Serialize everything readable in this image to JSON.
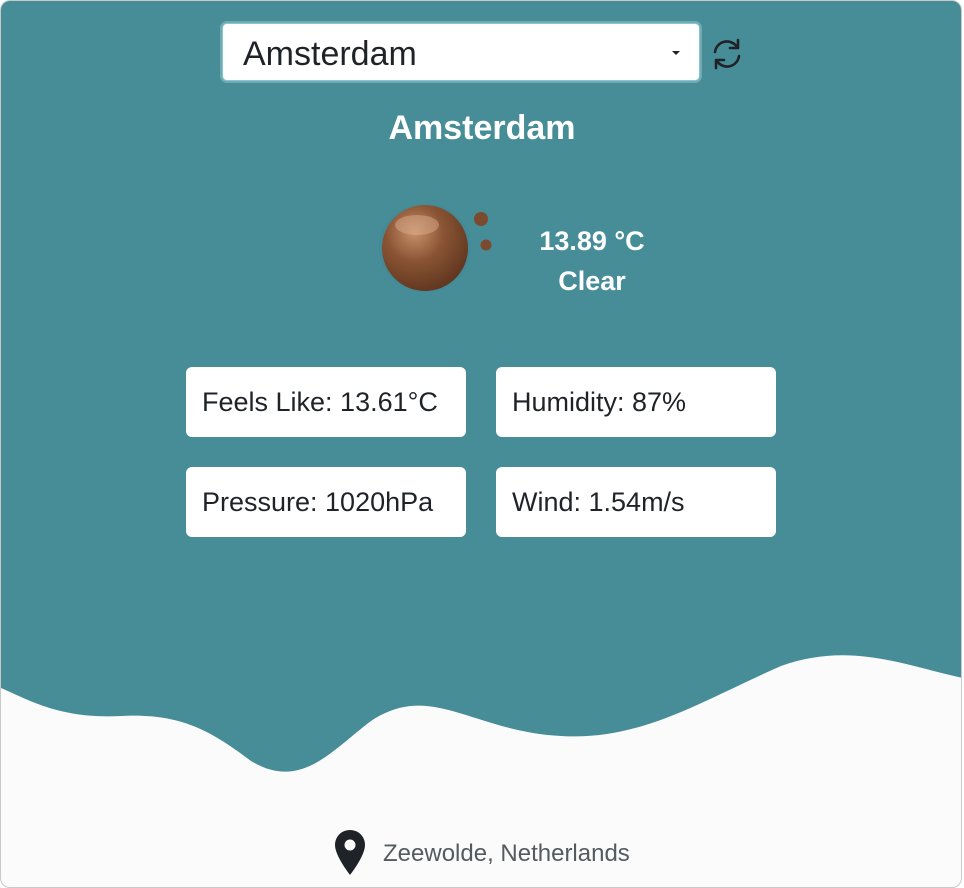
{
  "selector": {
    "selected_city": "Amsterdam"
  },
  "weather": {
    "city": "Amsterdam",
    "temperature": "13.89 °C",
    "condition": "Clear",
    "icon": "clear-weather-icon"
  },
  "stats": {
    "feels_like": "Feels Like: 13.61°C",
    "humidity": "Humidity: 87%",
    "pressure": "Pressure: 1020hPa",
    "wind": "Wind: 1.54m/s"
  },
  "footer": {
    "location": "Zeewolde, Netherlands"
  },
  "colors": {
    "teal": "#468d98",
    "card_bottom": "#fbfbfb",
    "text_dark": "#1f2328"
  }
}
